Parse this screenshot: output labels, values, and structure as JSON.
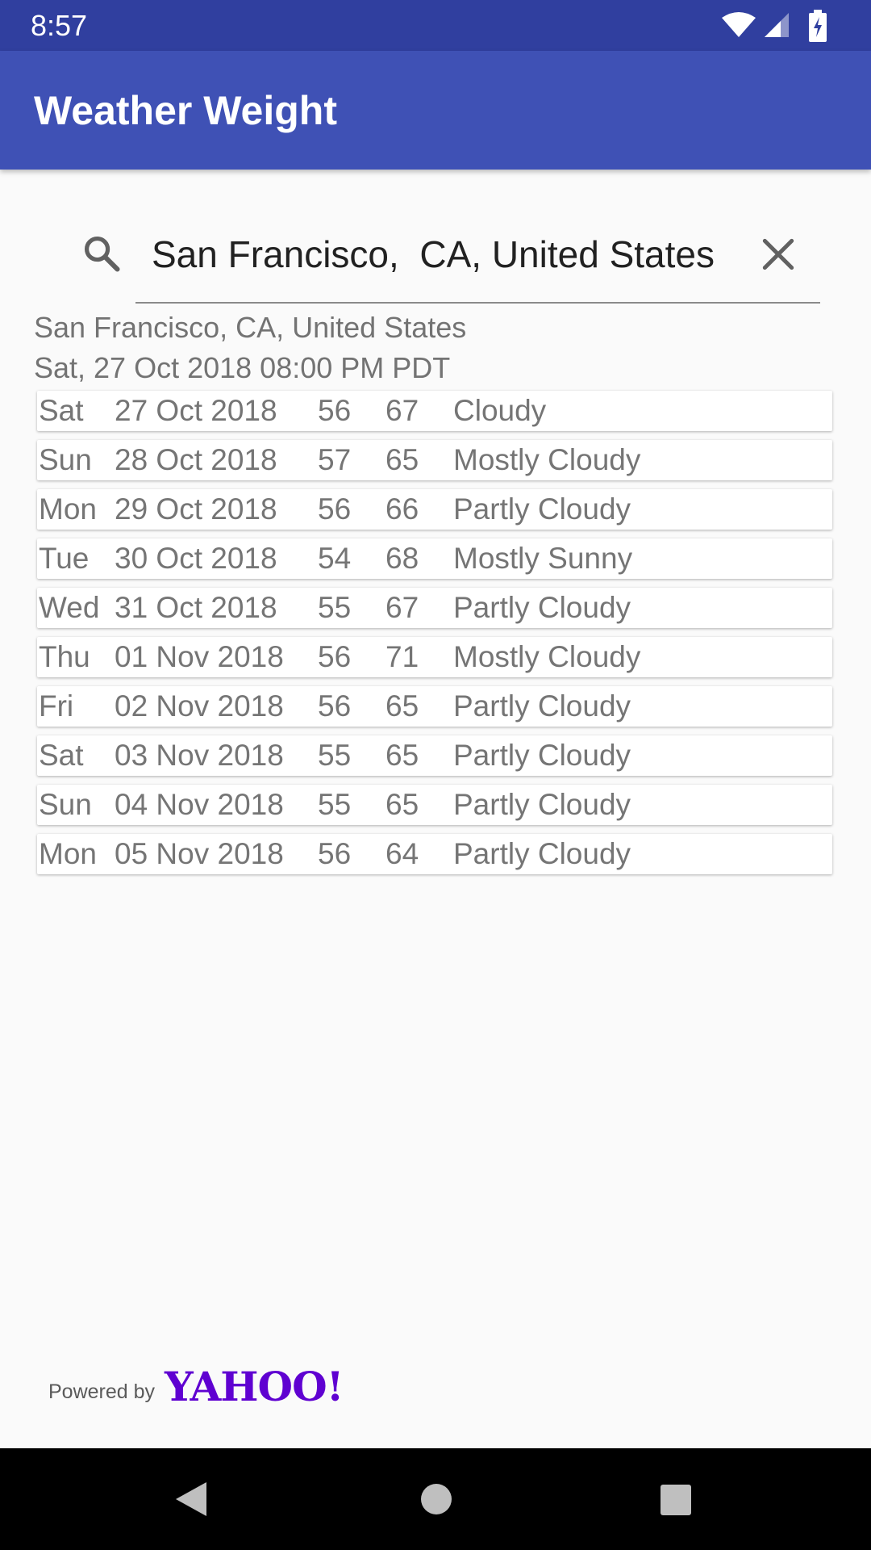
{
  "status_bar": {
    "time": "8:57"
  },
  "app_bar": {
    "title": "Weather Weight"
  },
  "search": {
    "value": "San Francisco,  CA, United States"
  },
  "location": "San Francisco,  CA, United States",
  "date": "Sat, 27 Oct 2018 08:00 PM PDT",
  "forecast": [
    {
      "day": "Sat",
      "date": "27 Oct 2018",
      "low": "56",
      "high": "67",
      "condition": "Cloudy"
    },
    {
      "day": "Sun",
      "date": "28 Oct 2018",
      "low": "57",
      "high": "65",
      "condition": "Mostly Cloudy"
    },
    {
      "day": "Mon",
      "date": "29 Oct 2018",
      "low": "56",
      "high": "66",
      "condition": "Partly Cloudy"
    },
    {
      "day": "Tue",
      "date": "30 Oct 2018",
      "low": "54",
      "high": "68",
      "condition": "Mostly Sunny"
    },
    {
      "day": "Wed",
      "date": "31 Oct 2018",
      "low": "55",
      "high": "67",
      "condition": "Partly Cloudy"
    },
    {
      "day": "Thu",
      "date": "01 Nov 2018",
      "low": "56",
      "high": "71",
      "condition": "Mostly Cloudy"
    },
    {
      "day": "Fri",
      "date": "02 Nov 2018",
      "low": "56",
      "high": "65",
      "condition": "Partly Cloudy"
    },
    {
      "day": "Sat",
      "date": "03 Nov 2018",
      "low": "55",
      "high": "65",
      "condition": "Partly Cloudy"
    },
    {
      "day": "Sun",
      "date": "04 Nov 2018",
      "low": "55",
      "high": "65",
      "condition": "Partly Cloudy"
    },
    {
      "day": "Mon",
      "date": "05 Nov 2018",
      "low": "56",
      "high": "64",
      "condition": "Partly Cloudy"
    }
  ],
  "attribution": {
    "powered_by": "Powered by",
    "brand": "YAHOO!"
  },
  "colors": {
    "primary_dark": "#303f9f",
    "primary": "#3f51b5",
    "yahoo_purple": "#5f01d1"
  }
}
